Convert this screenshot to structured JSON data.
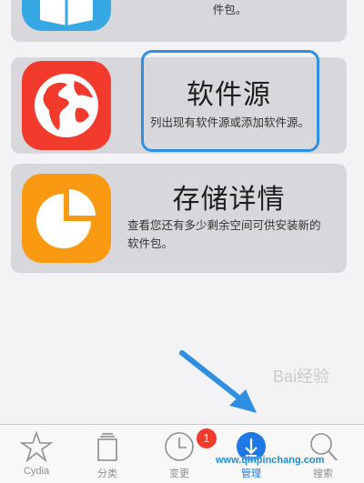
{
  "cards": {
    "installed": {
      "desc": "查看已安装软件包信息或管理已安装的软件包。",
      "icon": "open-box-icon"
    },
    "sources": {
      "title": "软件源",
      "desc": "列出现有软件源或添加软件源。",
      "icon": "globe-icon"
    },
    "storage": {
      "title": "存储详情",
      "desc": "查看您还有多少剩余空间可供安装新的软件包。",
      "icon": "pie-chart-icon"
    }
  },
  "tabs": [
    {
      "label": "Cydia",
      "icon": "star-icon"
    },
    {
      "label": "分类",
      "icon": "stack-icon"
    },
    {
      "label": "变更",
      "icon": "clock-icon",
      "badge": "1"
    },
    {
      "label": "管理",
      "icon": "download-icon",
      "active": true
    },
    {
      "label": "搜索",
      "icon": "search-icon"
    }
  ],
  "watermarks": {
    "site": "www.qinpinchang.com",
    "baidu": "Bai经验"
  },
  "colors": {
    "accent": "#1e78e6",
    "highlight": "#2f8fe0",
    "badge": "#f23a2d"
  }
}
